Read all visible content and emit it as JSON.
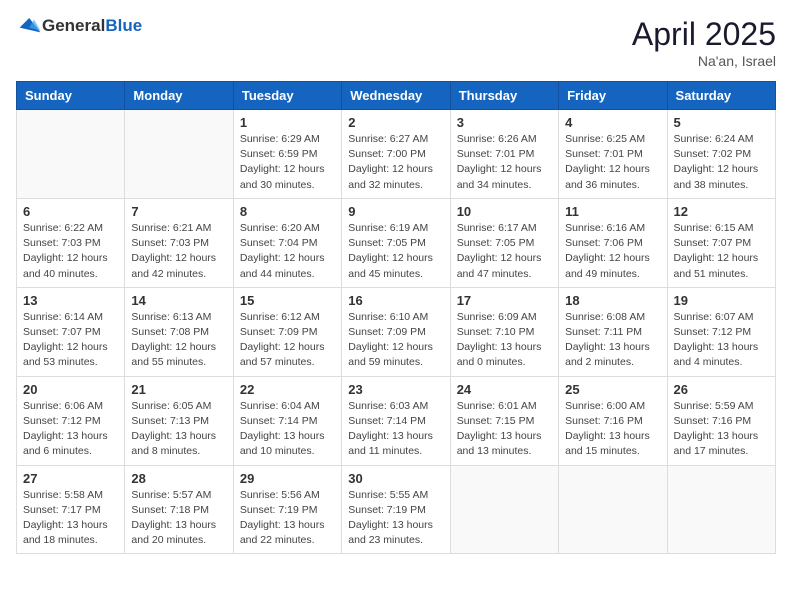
{
  "header": {
    "logo_general": "General",
    "logo_blue": "Blue",
    "month_year": "April 2025",
    "location": "Na'an, Israel"
  },
  "days_of_week": [
    "Sunday",
    "Monday",
    "Tuesday",
    "Wednesday",
    "Thursday",
    "Friday",
    "Saturday"
  ],
  "weeks": [
    [
      {
        "day": "",
        "info": ""
      },
      {
        "day": "",
        "info": ""
      },
      {
        "day": "1",
        "info": "Sunrise: 6:29 AM\nSunset: 6:59 PM\nDaylight: 12 hours\nand 30 minutes."
      },
      {
        "day": "2",
        "info": "Sunrise: 6:27 AM\nSunset: 7:00 PM\nDaylight: 12 hours\nand 32 minutes."
      },
      {
        "day": "3",
        "info": "Sunrise: 6:26 AM\nSunset: 7:01 PM\nDaylight: 12 hours\nand 34 minutes."
      },
      {
        "day": "4",
        "info": "Sunrise: 6:25 AM\nSunset: 7:01 PM\nDaylight: 12 hours\nand 36 minutes."
      },
      {
        "day": "5",
        "info": "Sunrise: 6:24 AM\nSunset: 7:02 PM\nDaylight: 12 hours\nand 38 minutes."
      }
    ],
    [
      {
        "day": "6",
        "info": "Sunrise: 6:22 AM\nSunset: 7:03 PM\nDaylight: 12 hours\nand 40 minutes."
      },
      {
        "day": "7",
        "info": "Sunrise: 6:21 AM\nSunset: 7:03 PM\nDaylight: 12 hours\nand 42 minutes."
      },
      {
        "day": "8",
        "info": "Sunrise: 6:20 AM\nSunset: 7:04 PM\nDaylight: 12 hours\nand 44 minutes."
      },
      {
        "day": "9",
        "info": "Sunrise: 6:19 AM\nSunset: 7:05 PM\nDaylight: 12 hours\nand 45 minutes."
      },
      {
        "day": "10",
        "info": "Sunrise: 6:17 AM\nSunset: 7:05 PM\nDaylight: 12 hours\nand 47 minutes."
      },
      {
        "day": "11",
        "info": "Sunrise: 6:16 AM\nSunset: 7:06 PM\nDaylight: 12 hours\nand 49 minutes."
      },
      {
        "day": "12",
        "info": "Sunrise: 6:15 AM\nSunset: 7:07 PM\nDaylight: 12 hours\nand 51 minutes."
      }
    ],
    [
      {
        "day": "13",
        "info": "Sunrise: 6:14 AM\nSunset: 7:07 PM\nDaylight: 12 hours\nand 53 minutes."
      },
      {
        "day": "14",
        "info": "Sunrise: 6:13 AM\nSunset: 7:08 PM\nDaylight: 12 hours\nand 55 minutes."
      },
      {
        "day": "15",
        "info": "Sunrise: 6:12 AM\nSunset: 7:09 PM\nDaylight: 12 hours\nand 57 minutes."
      },
      {
        "day": "16",
        "info": "Sunrise: 6:10 AM\nSunset: 7:09 PM\nDaylight: 12 hours\nand 59 minutes."
      },
      {
        "day": "17",
        "info": "Sunrise: 6:09 AM\nSunset: 7:10 PM\nDaylight: 13 hours\nand 0 minutes."
      },
      {
        "day": "18",
        "info": "Sunrise: 6:08 AM\nSunset: 7:11 PM\nDaylight: 13 hours\nand 2 minutes."
      },
      {
        "day": "19",
        "info": "Sunrise: 6:07 AM\nSunset: 7:12 PM\nDaylight: 13 hours\nand 4 minutes."
      }
    ],
    [
      {
        "day": "20",
        "info": "Sunrise: 6:06 AM\nSunset: 7:12 PM\nDaylight: 13 hours\nand 6 minutes."
      },
      {
        "day": "21",
        "info": "Sunrise: 6:05 AM\nSunset: 7:13 PM\nDaylight: 13 hours\nand 8 minutes."
      },
      {
        "day": "22",
        "info": "Sunrise: 6:04 AM\nSunset: 7:14 PM\nDaylight: 13 hours\nand 10 minutes."
      },
      {
        "day": "23",
        "info": "Sunrise: 6:03 AM\nSunset: 7:14 PM\nDaylight: 13 hours\nand 11 minutes."
      },
      {
        "day": "24",
        "info": "Sunrise: 6:01 AM\nSunset: 7:15 PM\nDaylight: 13 hours\nand 13 minutes."
      },
      {
        "day": "25",
        "info": "Sunrise: 6:00 AM\nSunset: 7:16 PM\nDaylight: 13 hours\nand 15 minutes."
      },
      {
        "day": "26",
        "info": "Sunrise: 5:59 AM\nSunset: 7:16 PM\nDaylight: 13 hours\nand 17 minutes."
      }
    ],
    [
      {
        "day": "27",
        "info": "Sunrise: 5:58 AM\nSunset: 7:17 PM\nDaylight: 13 hours\nand 18 minutes."
      },
      {
        "day": "28",
        "info": "Sunrise: 5:57 AM\nSunset: 7:18 PM\nDaylight: 13 hours\nand 20 minutes."
      },
      {
        "day": "29",
        "info": "Sunrise: 5:56 AM\nSunset: 7:19 PM\nDaylight: 13 hours\nand 22 minutes."
      },
      {
        "day": "30",
        "info": "Sunrise: 5:55 AM\nSunset: 7:19 PM\nDaylight: 13 hours\nand 23 minutes."
      },
      {
        "day": "",
        "info": ""
      },
      {
        "day": "",
        "info": ""
      },
      {
        "day": "",
        "info": ""
      }
    ]
  ]
}
